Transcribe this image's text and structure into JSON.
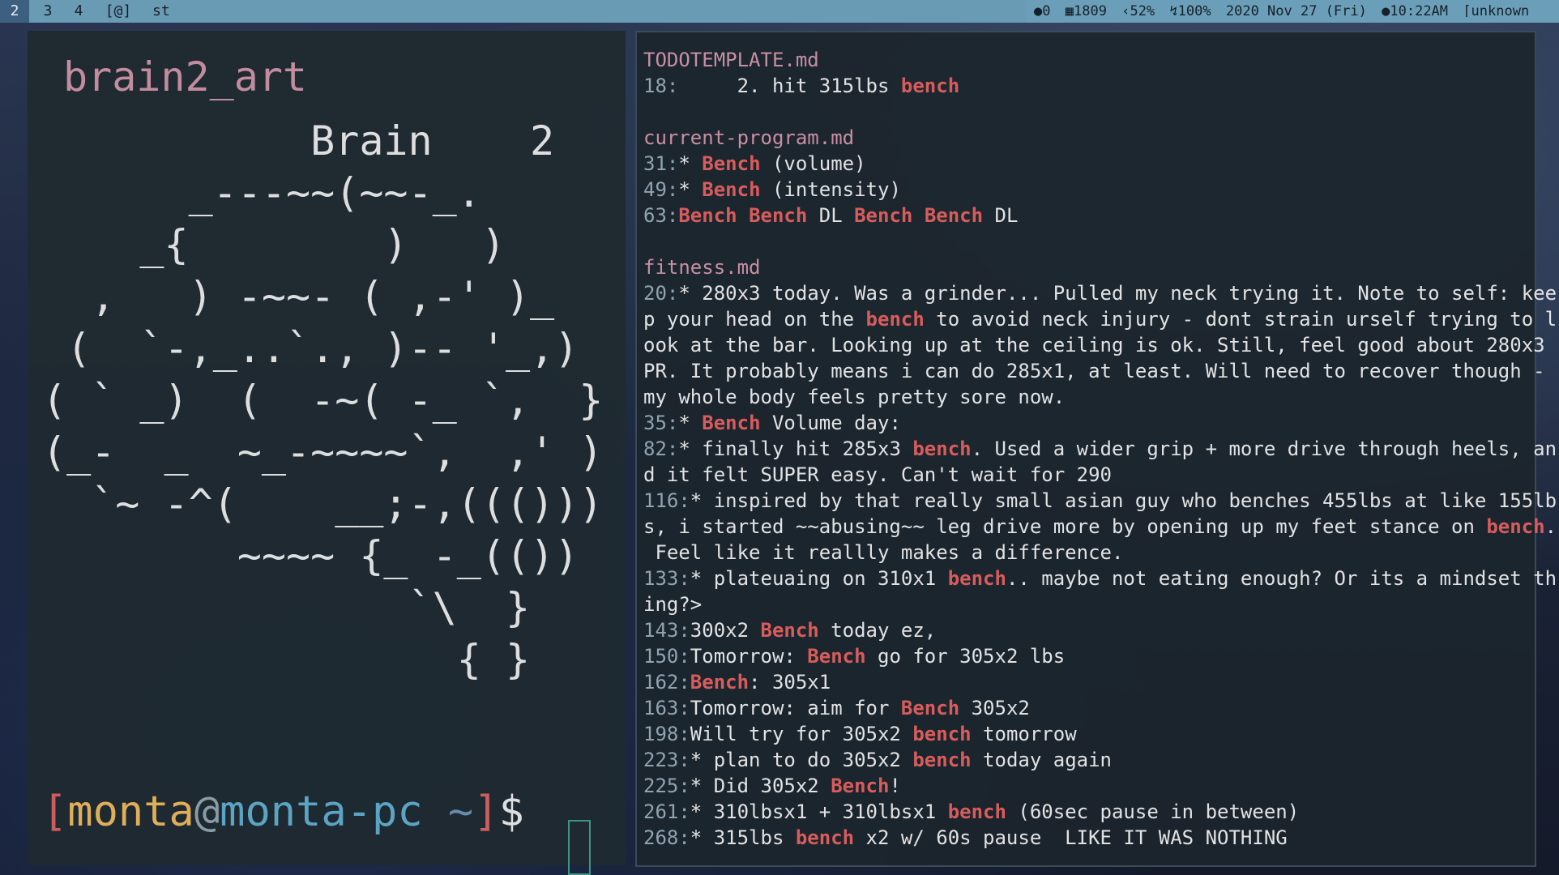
{
  "statusbar": {
    "workspaces": [
      {
        "label": "2",
        "active": true
      },
      {
        "label": "3",
        "active": false
      },
      {
        "label": "4",
        "active": false
      },
      {
        "label": "[@]",
        "active": false
      }
    ],
    "window_title": "st",
    "indicators": {
      "updates": "0",
      "memory": "1809",
      "volume": "52%",
      "battery": "100%",
      "date": "2020 Nov 27 (Fri)",
      "time": "10:22AM",
      "network": "unknown"
    }
  },
  "left_terminal": {
    "title": "brain2_art",
    "art_lines": [
      "           Brain    2",
      "      _---~~(~~-_.",
      "    _{        )   )",
      "  ,   ) -~~- ( ,-' )_",
      " (  `-,_..`., )-- '_,)",
      "( ` _)  (  -~( -_ `,  }",
      "(_-  _  ~_-~~~~`,  ,' )",
      "  `~ -^(    __;-,((()))",
      "        ~~~~ {_ -_(())",
      "               `\\  }",
      "                 { }"
    ],
    "prompt": {
      "open_bracket": "[",
      "user": "monta",
      "at": "@",
      "host": "monta-pc",
      "dir": " ~",
      "close_bracket": "]",
      "symbol": "$"
    }
  },
  "right_terminal": {
    "groups": [
      {
        "file": "TODOTEMPLATE.md",
        "lines": [
          {
            "num": "18:",
            "parts": [
              {
                "t": "     2. hit 315lbs "
              },
              {
                "t": "bench",
                "h": true
              }
            ]
          }
        ]
      },
      {
        "file": "current-program.md",
        "lines": [
          {
            "num": "31:",
            "parts": [
              {
                "t": "* "
              },
              {
                "t": "Bench",
                "h": true
              },
              {
                "t": " (volume)"
              }
            ]
          },
          {
            "num": "49:",
            "parts": [
              {
                "t": "* "
              },
              {
                "t": "Bench",
                "h": true
              },
              {
                "t": " (intensity)"
              }
            ]
          },
          {
            "num": "63:",
            "parts": [
              {
                "t": "Bench",
                "h": true
              },
              {
                "t": " "
              },
              {
                "t": "Bench",
                "h": true
              },
              {
                "t": " DL "
              },
              {
                "t": "Bench",
                "h": true
              },
              {
                "t": " "
              },
              {
                "t": "Bench",
                "h": true
              },
              {
                "t": " DL"
              }
            ]
          }
        ]
      },
      {
        "file": "fitness.md",
        "lines": [
          {
            "num": "20:",
            "parts": [
              {
                "t": "* 280x3 today. Was a grinder... Pulled my neck trying it. Note to self: kee"
              }
            ]
          },
          {
            "num": "",
            "parts": [
              {
                "t": "p your head on the "
              },
              {
                "t": "bench",
                "h": true
              },
              {
                "t": " to avoid neck injury - dont strain urself trying to l"
              }
            ]
          },
          {
            "num": "",
            "parts": [
              {
                "t": "ook at the bar. Looking up at the ceiling is ok. Still, feel good about 280x3"
              }
            ]
          },
          {
            "num": "",
            "parts": [
              {
                "t": "PR. It probably means i can do 285x1, at least. Will need to recover though -"
              }
            ]
          },
          {
            "num": "",
            "parts": [
              {
                "t": "my whole body feels pretty sore now."
              }
            ]
          },
          {
            "num": "35:",
            "parts": [
              {
                "t": "* "
              },
              {
                "t": "Bench",
                "h": true
              },
              {
                "t": " Volume day:"
              }
            ]
          },
          {
            "num": "82:",
            "parts": [
              {
                "t": "* finally hit 285x3 "
              },
              {
                "t": "bench",
                "h": true
              },
              {
                "t": ". Used a wider grip + more drive through heels, an"
              }
            ]
          },
          {
            "num": "",
            "parts": [
              {
                "t": "d it felt SUPER easy. Can't wait for 290"
              }
            ]
          },
          {
            "num": "116:",
            "parts": [
              {
                "t": "* inspired by that really small asian guy who benches 455lbs at like 155lb"
              }
            ]
          },
          {
            "num": "",
            "parts": [
              {
                "t": "s, i started ~~abusing~~ leg drive more by opening up my feet stance on "
              },
              {
                "t": "bench",
                "h": true
              },
              {
                "t": "."
              }
            ]
          },
          {
            "num": "",
            "parts": [
              {
                "t": " Feel like it reallly makes a difference."
              }
            ]
          },
          {
            "num": "133:",
            "parts": [
              {
                "t": "* plateuaing on 310x1 "
              },
              {
                "t": "bench",
                "h": true
              },
              {
                "t": ".. maybe not eating enough? Or its a mindset th"
              }
            ]
          },
          {
            "num": "",
            "parts": [
              {
                "t": "ing?>"
              }
            ]
          },
          {
            "num": "143:",
            "parts": [
              {
                "t": "300x2 "
              },
              {
                "t": "Bench",
                "h": true
              },
              {
                "t": " today ez,"
              }
            ]
          },
          {
            "num": "150:",
            "parts": [
              {
                "t": "Tomorrow: "
              },
              {
                "t": "Bench",
                "h": true
              },
              {
                "t": " go for 305x2 lbs"
              }
            ]
          },
          {
            "num": "162:",
            "parts": [
              {
                "t": "Bench",
                "h": true
              },
              {
                "t": ": 305x1"
              }
            ]
          },
          {
            "num": "163:",
            "parts": [
              {
                "t": "Tomorrow: aim for "
              },
              {
                "t": "Bench",
                "h": true
              },
              {
                "t": " 305x2"
              }
            ]
          },
          {
            "num": "198:",
            "parts": [
              {
                "t": "Will try for 305x2 "
              },
              {
                "t": "bench",
                "h": true
              },
              {
                "t": " tomorrow"
              }
            ]
          },
          {
            "num": "223:",
            "parts": [
              {
                "t": "* plan to do 305x2 "
              },
              {
                "t": "bench",
                "h": true
              },
              {
                "t": " today again"
              }
            ]
          },
          {
            "num": "225:",
            "parts": [
              {
                "t": "* Did 305x2 "
              },
              {
                "t": "Bench",
                "h": true
              },
              {
                "t": "!"
              }
            ]
          },
          {
            "num": "261:",
            "parts": [
              {
                "t": "* 310lbsx1 + 310lbsx1 "
              },
              {
                "t": "bench",
                "h": true
              },
              {
                "t": " (60sec pause in between)"
              }
            ]
          },
          {
            "num": "268:",
            "parts": [
              {
                "t": "* 315lbs "
              },
              {
                "t": "bench",
                "h": true
              },
              {
                "t": " x2 w/ 60s pause  LIKE IT WAS NOTHING"
              }
            ]
          }
        ]
      }
    ]
  }
}
